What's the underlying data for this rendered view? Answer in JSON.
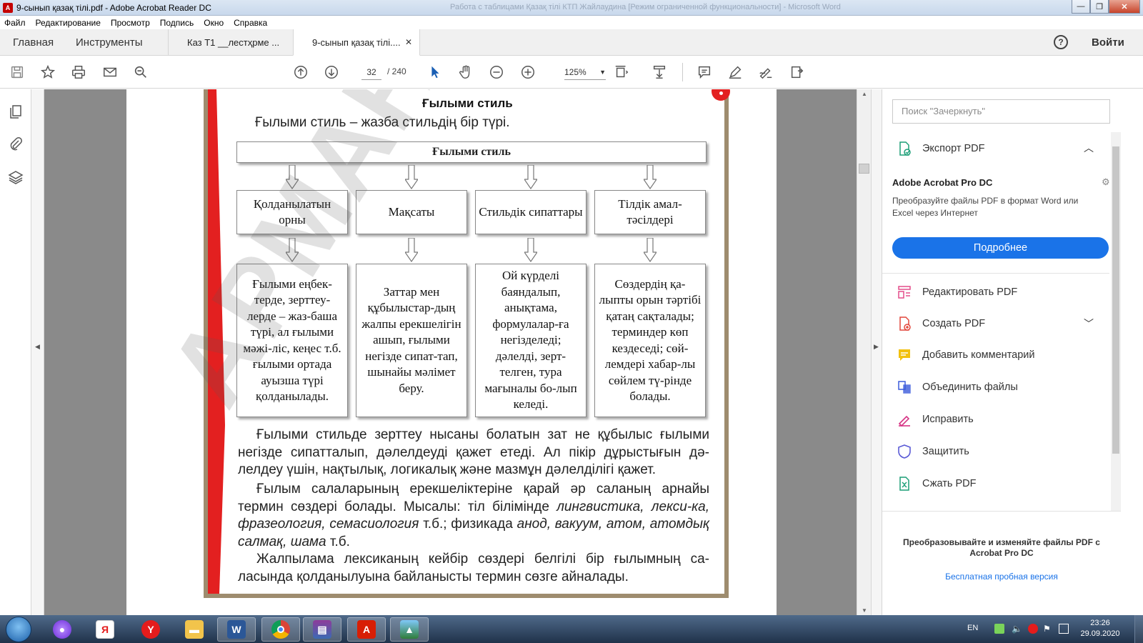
{
  "window": {
    "title": "9-сынып қазақ тілі.pdf - Adobe Acrobat Reader DC",
    "background_titles": "Работа с таблицами     Қазақ тілі КТП  Жайлаудина [Режим ограниченной функциональности] - Microsoft Word",
    "controls": {
      "minimize": "—",
      "maximize": "❐",
      "close": "✕"
    }
  },
  "menu": [
    "Файл",
    "Редактирование",
    "Просмотр",
    "Подпись",
    "Окно",
    "Справка"
  ],
  "tabs": {
    "home": "Главная",
    "tools": "Инструменты",
    "documents": [
      {
        "label": "Каз Т1 __лестҳрме ...",
        "active": false
      },
      {
        "label": "9-сынып қазақ тілі....",
        "active": true
      }
    ],
    "close_glyph": "✕",
    "help": "?",
    "login": "Войти"
  },
  "toolbar": {
    "current_page": "32",
    "total_pages": "/  240",
    "zoom": "125%",
    "icons": [
      "save-icon",
      "star-icon",
      "print-icon",
      "mail-icon",
      "search-zoom-icon",
      "page-up-icon",
      "page-down-icon",
      "select-cursor-icon",
      "hand-icon",
      "zoom-out-icon",
      "zoom-in-icon",
      "page-fit-icon",
      "scroll-mode-icon",
      "comment-icon",
      "pen-icon",
      "sign-icon",
      "share-icon"
    ]
  },
  "document": {
    "heading": "Ғылыми стиль",
    "intro": "Ғылыми стиль – жазба стильдің бір түрі.",
    "diagram": {
      "top": "Ғылыми стиль",
      "columns": [
        {
          "head": "Қолданылатын орны",
          "body": "Ғылыми еңбек-терде, зерттеу-лерде – жаз-баша түрі, ал ғылыми мәжі-ліс, кеңес т.б. ғылыми ортада ауызша түрі қолданылады."
        },
        {
          "head": "Мақсаты",
          "body": "Заттар мен құбылыстар-дың жалпы ерекшелігін ашып, ғылыми негізде сипат-тап, шынайы мәлімет беру."
        },
        {
          "head": "Стильдік сипаттары",
          "body": "Ой күрделі баяндалып, анықтама, формулалар-ға негізделеді; дәлелді, зерт-телген, тура мағыналы бо-лып келеді."
        },
        {
          "head": "Тілдік амал-тәсілдері",
          "body": "Сөздердің қа-лыпты орын тәртібі қатаң сақталады; терминдер көп кездеседі; сөй-лемдері хабар-лы сөйлем тү-рінде болады."
        }
      ]
    },
    "para1": "Ғылыми стильде зерттеу нысаны болатын зат не құбылыс ғылыми негізде сипатталып, дәлелдеуді қажет етеді. Ал пікір дұрыстығын дә-лелдеу үшін, нақтылық, логикалық және мазмұн дәлелділігі қажет.",
    "para2_start": "Ғылым салаларының ерекшеліктеріне қарай әр саланың арнайы термин сөздері болады. Мысалы: тіл білімінде ",
    "para2_italic1": "лингвистика, лекси-ка, фразеология, семасиология",
    "para2_mid": " т.б.; физикада ",
    "para2_italic2": "анод, вакуум, атом, атомдық салмақ, шама",
    "para2_end": " т.б.",
    "para3": "Жалпылама лексиканың кейбір сөздері белгілі бір ғылымның са-ласында қолданылуына байланысты термин сөзге айналады.",
    "watermark": "АРМАНПВ.бa"
  },
  "rightpanel": {
    "search_placeholder": "Поиск \"Зачеркнуть\"",
    "export": "Экспорт PDF",
    "promo_title": "Adobe Acrobat Pro DC",
    "promo_text": "Преобразуйте файлы PDF в формат Word или Excel через Интернет",
    "promo_button": "Подробнее",
    "tools": [
      {
        "label": "Редактировать PDF",
        "icon": "edit-pdf-icon"
      },
      {
        "label": "Создать PDF",
        "icon": "create-pdf-icon"
      },
      {
        "label": "Добавить комментарий",
        "icon": "comment-tool-icon"
      },
      {
        "label": "Объединить файлы",
        "icon": "combine-files-icon"
      },
      {
        "label": "Исправить",
        "icon": "fill-sign-icon"
      },
      {
        "label": "Защитить",
        "icon": "protect-icon"
      },
      {
        "label": "Сжать PDF",
        "icon": "compress-pdf-icon"
      }
    ],
    "bottom_text": "Преобразовывайте и изменяйте файлы PDF с Acrobat Pro DC",
    "bottom_link": "Бесплатная пробная версия"
  },
  "taskbar": {
    "language": "EN",
    "time": "23:26",
    "date": "29.09.2020",
    "apps": [
      "alice-icon",
      "yandex-browser-icon",
      "yandex-icon",
      "explorer-icon",
      "word-icon",
      "chrome-icon",
      "winrar-icon",
      "acrobat-icon",
      "photo-viewer-icon"
    ]
  },
  "colors": {
    "accent_blue": "#1a73e8",
    "red_strip": "#e32020",
    "frame": "#9e8c6e",
    "doc_bg": "#8a8a8a"
  }
}
